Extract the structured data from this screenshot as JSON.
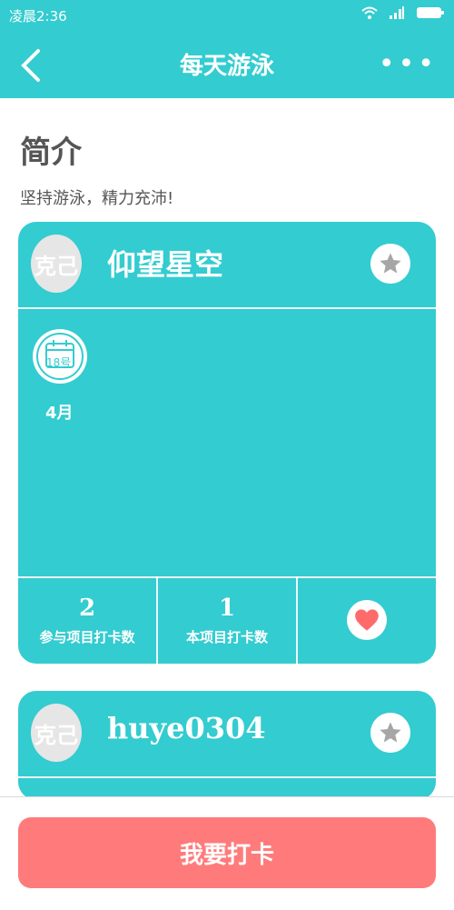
{
  "status_bar": {
    "time": "凌晨2:36"
  },
  "nav": {
    "title": "每天游泳",
    "more": "•••"
  },
  "intro": {
    "title": "简介",
    "description": "坚持游泳，精力充沛!"
  },
  "cards": [
    {
      "avatar_text": "克己",
      "username": "仰望星空",
      "calendar_day": "18号",
      "month": "4月",
      "stats": [
        {
          "value": "2",
          "label": "参与项目打卡数"
        },
        {
          "value": "1",
          "label": "本项目打卡数"
        }
      ]
    },
    {
      "avatar_text": "克己",
      "username": "huye0304"
    }
  ],
  "bottom": {
    "checkin_label": "我要打卡"
  },
  "colors": {
    "primary": "#33ccd0",
    "accent": "#ff7b7b",
    "heart": "#ff6b6b",
    "star": "#a6a6a6"
  }
}
